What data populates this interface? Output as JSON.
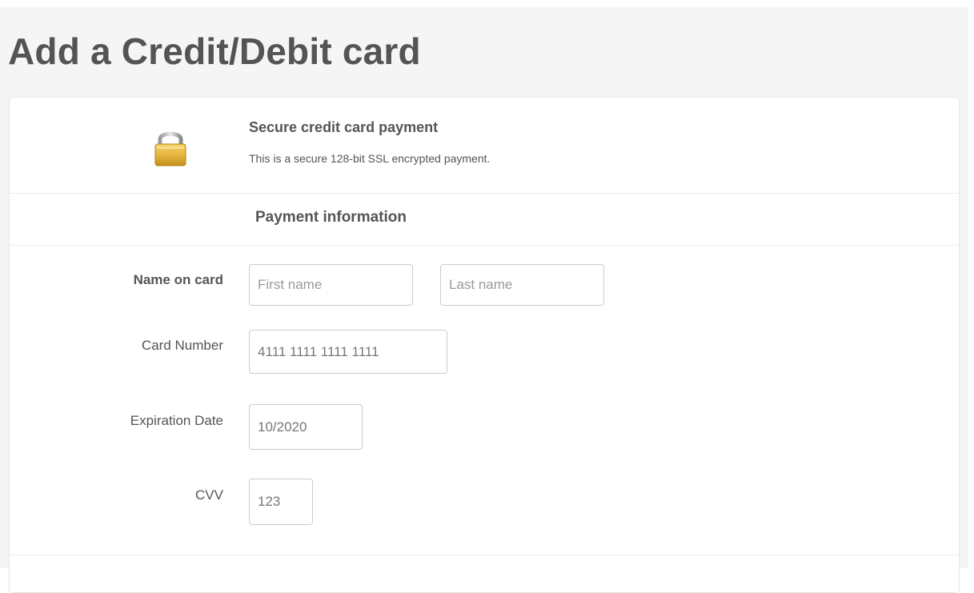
{
  "page": {
    "title": "Add a Credit/Debit card"
  },
  "secure": {
    "icon": "lock-icon",
    "title": "Secure credit card payment",
    "text": "This is a secure 128-bit SSL encrypted payment."
  },
  "payment": {
    "heading": "Payment information"
  },
  "form": {
    "name_label": "Name on card",
    "first_name_placeholder": "First name",
    "last_name_placeholder": "Last name",
    "card_number_label": "Card Number",
    "card_number_value": "4111 1111 1111 1111",
    "expiration_label": "Expiration Date",
    "expiration_value": "10/2020",
    "cvv_label": "CVV",
    "cvv_value": "123"
  },
  "colors": {
    "page_background": "#f5f5f5",
    "title_text": "#545454",
    "body_text": "#555555",
    "input_border": "#cccccc",
    "lock_gold": "#e0b43a"
  }
}
